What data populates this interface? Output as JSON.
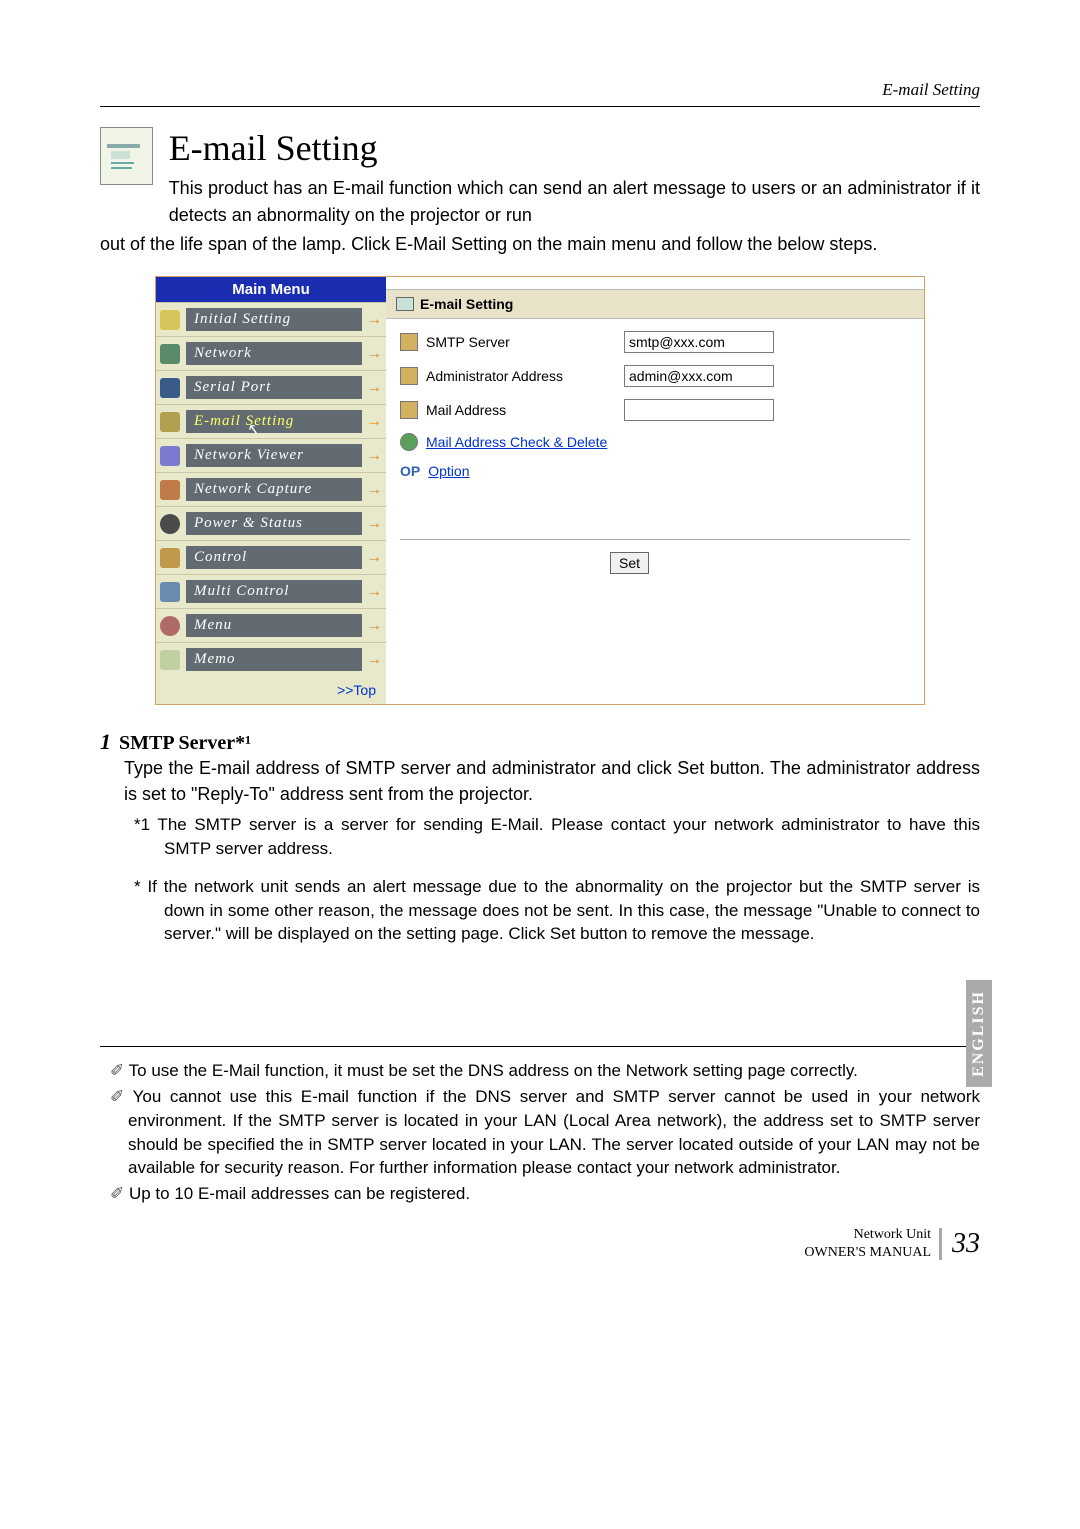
{
  "header_label": "E-mail Setting",
  "title": "E-mail Setting",
  "intro_top": "This product has an E-mail function which can send an alert message to users or an administrator if it detects an abnormality on the projector or run",
  "intro_below": "out of the life span of the lamp. Click E-Mail Setting on the main menu and follow the below steps.",
  "menu": {
    "header": "Main Menu",
    "items": [
      {
        "label": "Initial Setting"
      },
      {
        "label": "Network"
      },
      {
        "label": "Serial Port"
      },
      {
        "label": "E-mail Setting"
      },
      {
        "label": "Network Viewer"
      },
      {
        "label": "Network Capture"
      },
      {
        "label": "Power & Status"
      },
      {
        "label": "Control"
      },
      {
        "label": "Multi Control"
      },
      {
        "label": "Menu"
      },
      {
        "label": "Memo"
      }
    ],
    "top_link": ">>Top"
  },
  "form": {
    "header": "E-mail Setting",
    "smtp_label": "SMTP Server",
    "smtp_value": "smtp@xxx.com",
    "admin_label": "Administrator Address",
    "admin_value": "admin@xxx.com",
    "mail_label": "Mail Address",
    "mail_value": "",
    "check_link": "Mail Address Check & Delete",
    "option_prefix": "OP",
    "option_link": "Option",
    "set_button": "Set"
  },
  "step": {
    "num": "1",
    "title": "SMTP Server*¹",
    "body": "Type the E-mail address of SMTP server and administrator and click Set button. The administrator address is set to \"Reply-To\" address sent from the projector.",
    "footnote1": "*1 The SMTP server is a server for sending E-Mail. Please contact your network administrator to have this SMTP server address.",
    "footnote2": "* If the network unit sends an alert message due to the abnormality on the projector but the SMTP server is down in some other reason, the message does not be sent. In this case, the message \"Unable to connect to server.\" will be displayed on the setting page. Click Set button to remove the message."
  },
  "notes": {
    "n1": "To use the E-Mail function, it must be set the DNS address on the Network setting page correctly.",
    "n2": "You cannot use this E-mail function if the DNS server and SMTP server cannot be used in your network environment. If the SMTP server is located in your LAN (Local Area network), the address set to SMTP server should be specified the in SMTP server located in your LAN. The server located outside of your LAN may not be available for security reason. For further information please contact your network administrator.",
    "n3": "Up to 10 E-mail addresses can be registered."
  },
  "tab": "ENGLISH",
  "footer": {
    "line1": "Network Unit",
    "line2": "OWNER'S MANUAL",
    "page": "33"
  }
}
